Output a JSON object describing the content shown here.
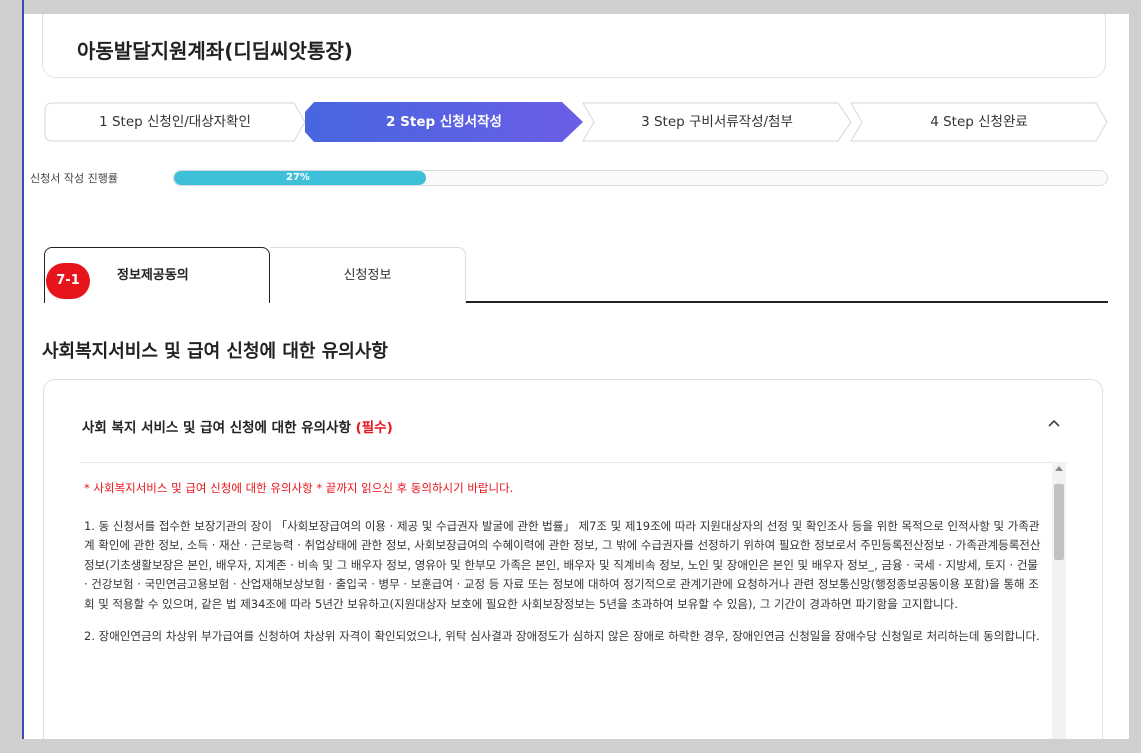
{
  "page_title": "아동발달지원계좌(디딤씨앗통장)",
  "steps": [
    {
      "label": "1 Step 신청인/대상자확인",
      "active": false
    },
    {
      "label": "2 Step 신청서작성",
      "active": true
    },
    {
      "label": "3 Step 구비서류작성/첨부",
      "active": false
    },
    {
      "label": "4 Step 신청완료",
      "active": false
    }
  ],
  "progress": {
    "label": "신청서 작성 진행률",
    "percent_text": "27%",
    "value": 27,
    "color": "#3ec0d8"
  },
  "tabs": {
    "badge": "7-1",
    "items": [
      {
        "label": "정보제공동의"
      },
      {
        "label": "신청정보"
      }
    ]
  },
  "section_title": "사회복지서비스 및 급여 신청에 대한 유의사항",
  "notice": {
    "heading": "사회 복지 서비스 및 급여 신청에 대한 유의사항",
    "required": "(필수)",
    "warning": "* 사회복지서비스 및 급여 신청에 대한 유의사항 * 끝까지 읽으신 후 동의하시기 바랍니다.",
    "paragraphs": [
      "1. 동 신청서를 접수한 보장기관의 장이 「사회보장급여의 이용 · 제공 및 수급권자 발굴에 관한 법률」 제7조 및 제19조에 따라 지원대상자의 선정 및 확인조사 등을 위한 목적으로 인적사항 및 가족관계 확인에 관한 정보, 소득 · 재산 · 근로능력 · 취업상태에 관한 정보, 사회보장급여의 수혜이력에 관한 정보, 그 밖에 수급권자를 선정하기 위하여 필요한 정보로서 주민등록전산정보 · 가족관계등록전산정보(기초생활보장은 본인, 배우자, 지계존 · 비속 및 그 배우자 정보, 영유아 및 한부모 가족은 본인, 배우자 및 직계비속 정보, 노인 및 장애인은 본인 및 배우자 정보_, 금융 · 국세 · 지방세, 토지 · 건물 · 건강보험 · 국민연금고용보험 · 산업재해보상보험 · 출입국 · 병무 · 보훈급여 · 교정 등 자료 또는 정보에 대하여 정기적으로 관계기관에 요청하거나 관련 정보통신망(행정종보공동이용 포함)을 통해 조회 및 적용할 수 있으며, 같은 법 제34조에 따라 5년간 보유하고(지원대상자 보호에 필요한 사회보장정보는 5년을 초과하여 보유할 수 있음), 그 기간이 경과하면 파기함을 고지합니다.",
      "2. 장애인연금의 차상위 부가급여를 신청하여 차상위 자격이 확인되었으나, 위탁 심사결과 장애정도가 심하지 않은 장애로 하락한 경우, 장애인연금 신청일을 장애수당 신청일로 처리하는데 동의합니다."
    ]
  },
  "colors": {
    "accent": "#4f5fe0",
    "badge": "#e8141c"
  }
}
